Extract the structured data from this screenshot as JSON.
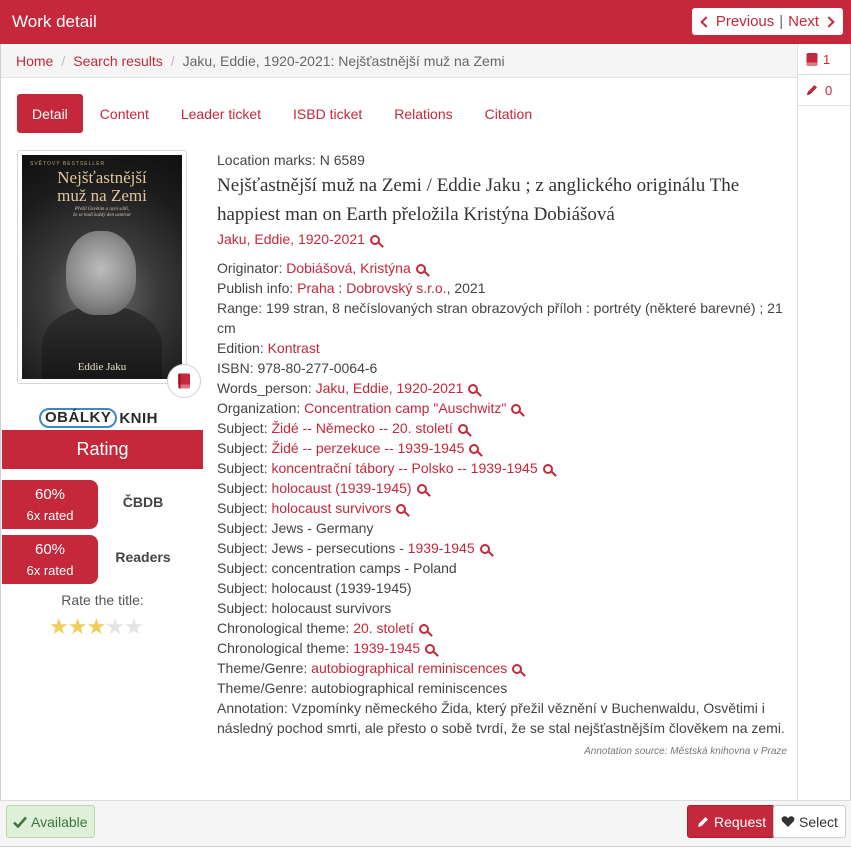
{
  "header": {
    "title": "Work detail",
    "previous_label": "Previous",
    "separator": "|",
    "next_label": "Next"
  },
  "breadcrumb": {
    "home": "Home",
    "search_results": "Search results",
    "current": "Jaku, Eddie, 1920-2021: Nejšťastnější muž na Zemi"
  },
  "side_panel": {
    "book_count": "1",
    "edit_count": "0"
  },
  "tabs": [
    {
      "label": "Detail",
      "active": true
    },
    {
      "label": "Content",
      "active": false
    },
    {
      "label": "Leader ticket",
      "active": false
    },
    {
      "label": "ISBD ticket",
      "active": false
    },
    {
      "label": "Relations",
      "active": false
    },
    {
      "label": "Citation",
      "active": false
    }
  ],
  "cover": {
    "top_text": "SVĚTOVÝ BESTSELLER",
    "title_line1": "Nejšťastnější",
    "title_line2": "muž na Zemi",
    "subtitle_line1": "Přežil Osvětim a nyní sdílí,",
    "subtitle_line2": "že se hodí každý den usmívat",
    "author": "Eddie Jaku"
  },
  "obalky": {
    "part1": "OBÁLKY",
    "part2": "KNIH"
  },
  "rating": {
    "heading": "Rating",
    "cbdb": {
      "percent": "60%",
      "count": "6x rated",
      "label": "ČBDB",
      "level": 0.6
    },
    "readers": {
      "percent": "60%",
      "count": "6x rated",
      "label": "Readers",
      "level": 0.6
    },
    "rate_title": "Rate the title:",
    "stars_filled": 3,
    "stars_total": 5
  },
  "details": {
    "location_marks": "Location marks: N 6589",
    "title": "Nejšťastnější muž na Zemi / Eddie Jaku ; z anglického originálu The happiest man on Earth přeložila Kristýna Dobiášová",
    "author_link": "Jaku, Eddie, 1920-2021",
    "originator_label": "Originator: ",
    "originator_value": "Dobiášová, Kristýna",
    "publish_label": "Publish info: ",
    "publish_place": "Praha",
    "publish_colon": " : ",
    "publish_publisher": "Dobrovský s.r.o.",
    "publish_year": ", 2021",
    "range": "Range: 199 stran, 8 nečíslovaných stran obrazových příloh : portréty (některé barevné) ; 21 cm",
    "edition_label": "Edition: ",
    "edition_value": "Kontrast",
    "isbn": "ISBN: 978-80-277-0064-6",
    "words_person_label": "Words_person: ",
    "words_person_value": "Jaku, Eddie, 1920-2021",
    "organization_label": "Organization: ",
    "organization_value": "Concentration camp \"Auschwitz\"",
    "subject_label": "Subject: ",
    "subject_links": [
      "Židé -- Německo -- 20. století",
      "Židé -- perzekuce -- 1939-1945",
      "koncentrační tábory -- Polsko -- 1939-1945",
      "holocaust (1939-1945)",
      "holocaust survivors"
    ],
    "subject_jews_persecutions_prefix": "Jews - persecutions - ",
    "subject_jews_persecutions_link": "1939-1945",
    "subject_plain": [
      "Jews - Germany",
      "concentration camps - Poland",
      "holocaust (1939-1945)",
      "holocaust survivors"
    ],
    "chrono_label": "Chronological theme: ",
    "chrono_values": [
      "20. století",
      "1939-1945"
    ],
    "theme_label": "Theme/Genre: ",
    "theme_link": "autobiographical reminiscences",
    "theme_plain": "autobiographical reminiscences",
    "annotation": "Annotation: Vzpomínky německého Žida, který přežil věznění v Buchenwaldu, Osvětimi i následný pochod smrti, ale přesto o sobě tvrdí, že se stal nejšťastnějším člověkem na zemi.",
    "annotation_source": "Annotation source: Městská knihovna v Praze"
  },
  "footer": {
    "available_label": "Available",
    "request_label": "Request",
    "select_label": "Select"
  },
  "colors": {
    "accent": "#c5283a",
    "available_bg": "#dff0d8",
    "available_text": "#3c763d",
    "star_on": "#f1ce5a",
    "star_off": "#e4e4e4"
  },
  "icons": {
    "previous": "chevron-left-icon",
    "next": "chevron-right-icon",
    "book": "book-icon",
    "edit": "pencil-icon",
    "search": "search-icon",
    "available": "check-icon",
    "request": "pencil-icon",
    "select": "heart-icon",
    "star": "star-icon"
  }
}
